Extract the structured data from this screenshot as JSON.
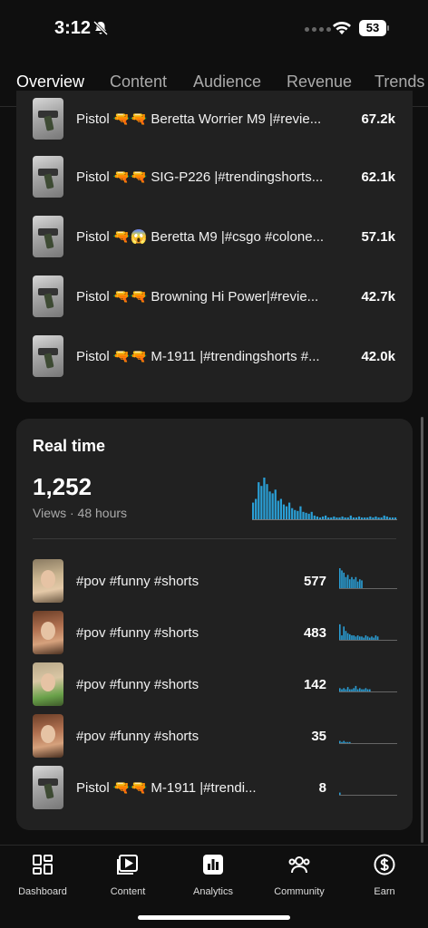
{
  "status": {
    "time": "3:12",
    "battery": "53"
  },
  "tabs": [
    "Overview",
    "Content",
    "Audience",
    "Revenue",
    "Trends"
  ],
  "top_videos": [
    {
      "title": "Pistol 🔫🔫 Beretta Worrier M9 |#revie...",
      "value": "67.2k"
    },
    {
      "title": "Pistol 🔫🔫 SIG-P226 |#trendingshorts...",
      "value": "62.1k"
    },
    {
      "title": "Pistol 🔫😱 Beretta M9 |#csgo #colone...",
      "value": "57.1k"
    },
    {
      "title": "Pistol 🔫🔫 Browning Hi Power|#revie...",
      "value": "42.7k"
    },
    {
      "title": "Pistol 🔫🔫 M-1911 |#trendingshorts #...",
      "value": "42.0k"
    }
  ],
  "realtime": {
    "title": "Real time",
    "total": "1,252",
    "subtitle": "Views · 48 hours",
    "bars": [
      18,
      22,
      40,
      36,
      45,
      38,
      30,
      28,
      32,
      20,
      22,
      16,
      14,
      18,
      12,
      10,
      9,
      14,
      8,
      7,
      6,
      8,
      4,
      3,
      2,
      3,
      4,
      2,
      2,
      3,
      2,
      2,
      3,
      2,
      2,
      4,
      2,
      2,
      3,
      2,
      2,
      2,
      3,
      2,
      3,
      2,
      2,
      4,
      3,
      2,
      2,
      2
    ],
    "videos": [
      {
        "title": "#pov #funny #shorts",
        "value": "577",
        "spark": [
          18,
          16,
          14,
          10,
          12,
          8,
          10,
          8,
          10,
          6,
          8,
          7
        ]
      },
      {
        "title": "#pov #funny #shorts",
        "value": "483",
        "spark": [
          14,
          4,
          12,
          8,
          6,
          5,
          4,
          4,
          3,
          4,
          3,
          3,
          2,
          4,
          3,
          2,
          3,
          2,
          4,
          3
        ]
      },
      {
        "title": "#pov #funny #shorts",
        "value": "142",
        "spark": [
          3,
          2,
          3,
          2,
          4,
          2,
          2,
          3,
          5,
          2,
          3,
          2,
          2,
          3,
          2,
          2
        ]
      },
      {
        "title": "#pov #funny #shorts",
        "value": "35",
        "spark": [
          2,
          1,
          2,
          1,
          1,
          1
        ]
      },
      {
        "title": "Pistol 🔫🔫 M-1911 |#trendi...",
        "value": "8",
        "spark": [
          2
        ]
      }
    ]
  },
  "nav": [
    {
      "label": "Dashboard",
      "icon": "dashboard-icon"
    },
    {
      "label": "Content",
      "icon": "content-icon"
    },
    {
      "label": "Analytics",
      "icon": "analytics-icon"
    },
    {
      "label": "Community",
      "icon": "community-icon"
    },
    {
      "label": "Earn",
      "icon": "earn-icon"
    }
  ],
  "colors": {
    "accent_bar": "#2a9fd6",
    "card": "#212121",
    "background": "#0f0f0f"
  }
}
